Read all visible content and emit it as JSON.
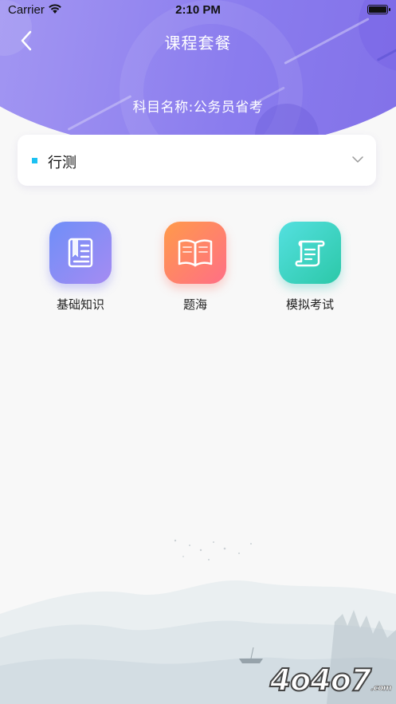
{
  "status_bar": {
    "carrier": "Carrier",
    "time": "2:10 PM"
  },
  "header": {
    "title": "课程套餐",
    "subject": "科目名称:公务员省考",
    "gradient_colors": [
      "#a9a0f3",
      "#7f6de6"
    ]
  },
  "selector": {
    "value": "行测",
    "accent": "#1cc1f2"
  },
  "menu": {
    "items": [
      {
        "label": "基础知识",
        "icon": "notebook-icon",
        "colors": [
          "#6f8ff8",
          "#a58bf2"
        ]
      },
      {
        "label": "题海",
        "icon": "open-book-icon",
        "colors": [
          "#ff9a4a",
          "#ff6f86"
        ]
      },
      {
        "label": "模拟考试",
        "icon": "scroll-icon",
        "colors": [
          "#54e0e0",
          "#2cc8a8"
        ]
      }
    ]
  },
  "watermark": {
    "text": "4o4o7",
    "suffix": ".com"
  }
}
